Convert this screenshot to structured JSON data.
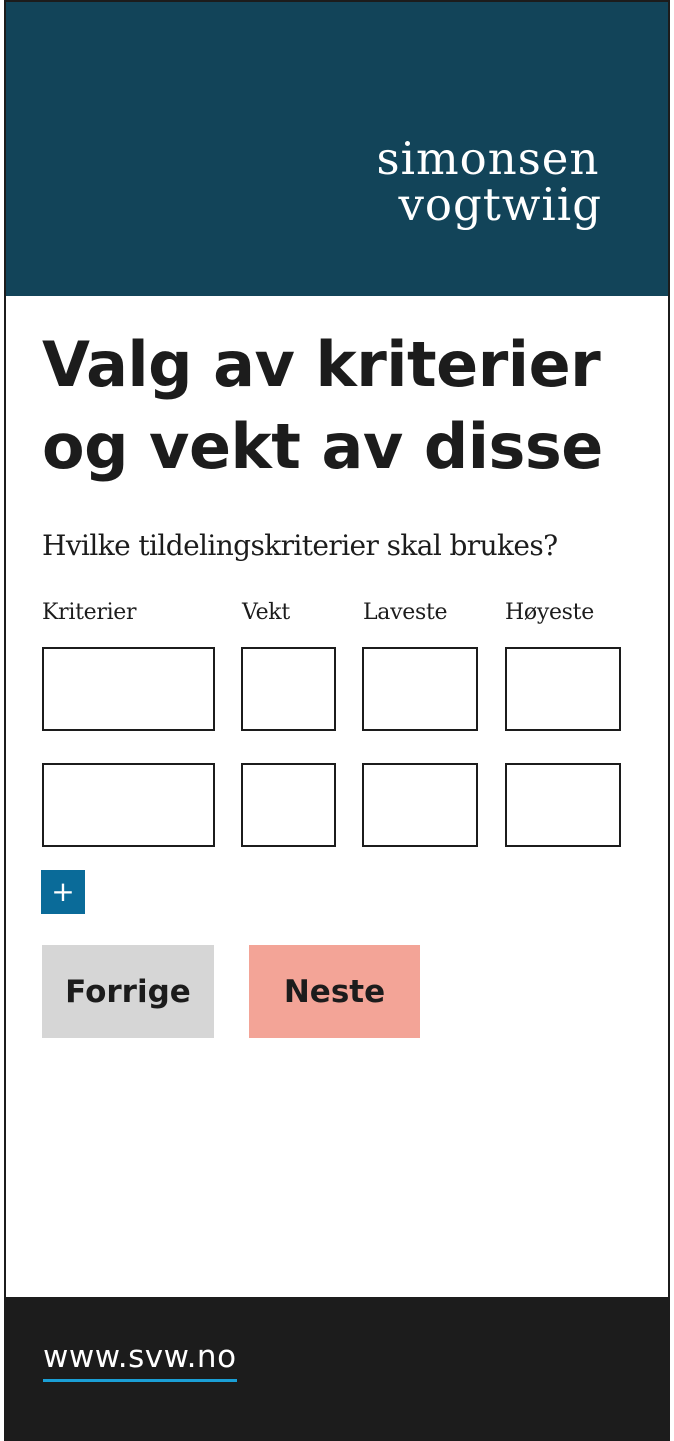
{
  "header": {
    "logo_line1": "simonsen",
    "logo_line2": "vogtwiig",
    "background": "#124459"
  },
  "page_title": "Valg av kriterier og vekt av disse",
  "question": "Hvilke tildelingskriterier skal brukes?",
  "columns": [
    "Kriterier",
    "Vekt",
    "Laveste",
    "Høyeste"
  ],
  "rows": [
    {
      "kriterier": "",
      "vekt": "",
      "laveste": "",
      "hoyeste": ""
    },
    {
      "kriterier": "",
      "vekt": "",
      "laveste": "",
      "hoyeste": ""
    }
  ],
  "add_row_label": "+",
  "buttons": {
    "prev_label": "Forrige",
    "next_label": "Neste"
  },
  "footer": {
    "link_text": "www.svw.no",
    "accent": "#1a9fd6"
  },
  "colors": {
    "add_button": "#0a6b99",
    "prev_button": "#d6d6d6",
    "next_button": "#f3a497",
    "footer_bg": "#1c1c1c"
  }
}
